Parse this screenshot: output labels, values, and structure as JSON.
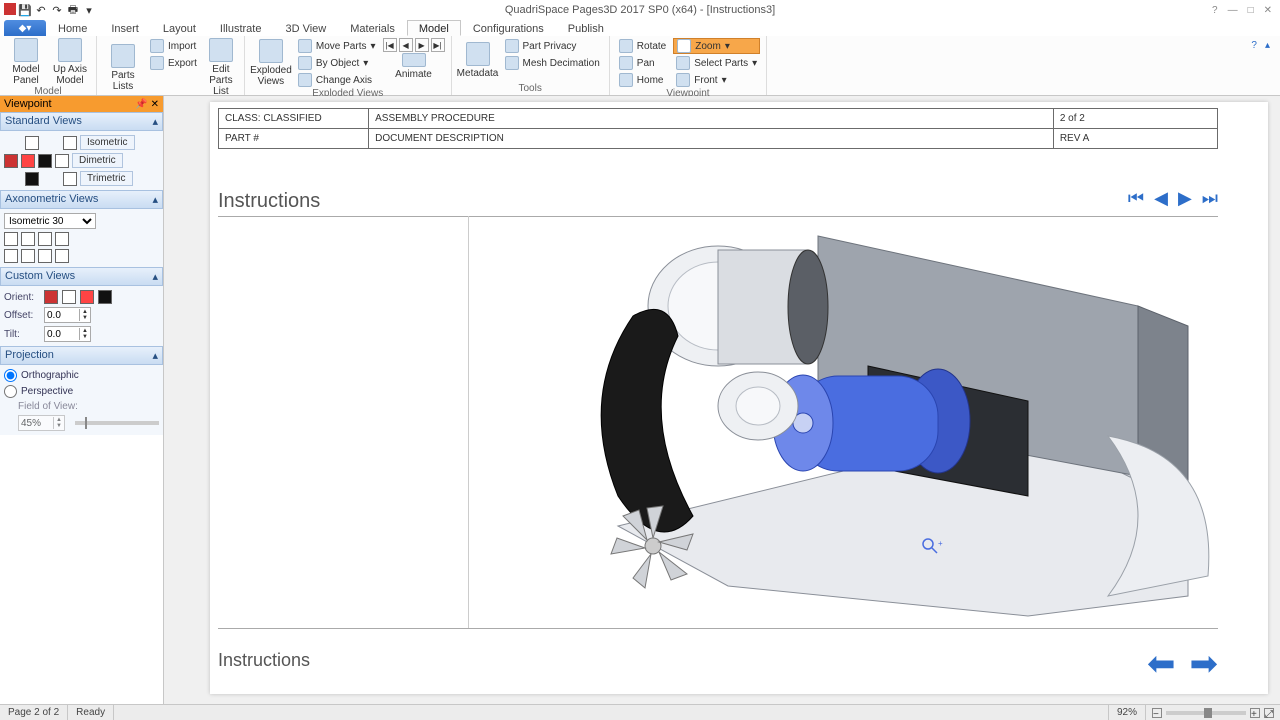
{
  "app": {
    "title": "QuadriSpace Pages3D  2017 SP0 (x64) - [Instructions3]"
  },
  "tabs": {
    "home": "Home",
    "insert": "Insert",
    "layout": "Layout",
    "illustrate": "Illustrate",
    "view3d": "3D View",
    "materials": "Materials",
    "model": "Model",
    "config": "Configurations",
    "publish": "Publish"
  },
  "ribbon": {
    "modelPanel": "Model Panel",
    "upAxisModel": "Up Axis Model",
    "partsLists": "Parts Lists",
    "import": "Import",
    "export": "Export",
    "editPartsList": "Edit Parts List",
    "explodedViews": "Exploded Views",
    "moveParts": "Move Parts",
    "byObject": "By Object",
    "changeAxis": "Change Axis",
    "animate": "Animate",
    "metadata": "Metadata",
    "partPrivacy": "Part Privacy",
    "meshDecimation": "Mesh Decimation",
    "rotate": "Rotate",
    "zoom": "Zoom",
    "pan": "Pan",
    "selectParts": "Select Parts",
    "homeBtn": "Home",
    "front": "Front",
    "grpModel": "Model",
    "grpPartsLists": "Parts Lists",
    "grpExploded": "Exploded Views",
    "grpTools": "Tools",
    "grpViewpoint": "Viewpoint"
  },
  "sidepanel": {
    "title": "Viewpoint",
    "stdViews": "Standard Views",
    "iso": "Isometric",
    "di": "Dimetric",
    "tri": "Trimetric",
    "axoViews": "Axonometric Views",
    "axoSelect": "Isometric 30",
    "customViews": "Custom Views",
    "orient": "Orient:",
    "offset": "Offset:",
    "tilt": "Tilt:",
    "offsetVal": "0.0",
    "tiltVal": "0.0",
    "projection": "Projection",
    "ortho": "Orthographic",
    "persp": "Perspective",
    "fov": "Field of View:",
    "fovVal": "45%"
  },
  "doc": {
    "class": "CLASS: CLASSIFIED",
    "assembly": "ASSEMBLY PROCEDURE",
    "page": "2 of 2",
    "partnum": "PART #",
    "docdesc": "DOCUMENT DESCRIPTION",
    "rev": "REV A",
    "instructions": "Instructions"
  },
  "status": {
    "page": "Page 2 of 2",
    "ready": "Ready",
    "zoom": "92%"
  }
}
